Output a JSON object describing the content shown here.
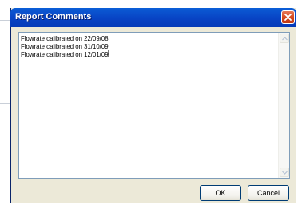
{
  "dialog": {
    "title": "Report Comments",
    "close_icon": "close-icon",
    "comments": [
      "Flowrate calibrated on 22/09/08",
      "Flowrate calibrated on 31/10/09",
      "Flowrate calibrated on 12/01/09"
    ],
    "scroll_up_icon": "scroll-up-arrow-icon",
    "scroll_down_icon": "scroll-down-arrow-icon",
    "ok_label": "OK",
    "cancel_label": "Cancel"
  },
  "colors": {
    "titlebar": "#0843c4",
    "close_button": "#d4461c",
    "dialog_face": "#ece9d8",
    "field_border": "#7f9db9"
  }
}
